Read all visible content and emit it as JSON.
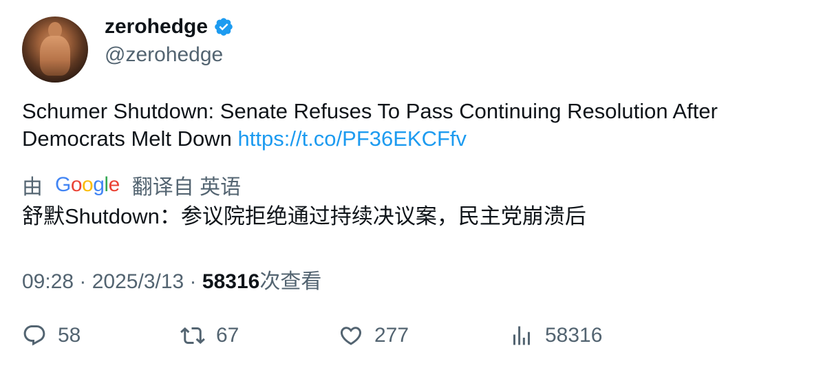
{
  "author": {
    "name": "zerohedge",
    "handle": "@zerohedge",
    "verified_icon": "verified-badge-icon",
    "avatar_icon": "avatar"
  },
  "tweet": {
    "text": "Schumer Shutdown: Senate Refuses To Pass Continuing Resolution After Democrats Melt Down ",
    "link": "https://t.co/PF36EKCFfv"
  },
  "translation": {
    "prefix": "由",
    "provider_logo_letters": [
      "G",
      "o",
      "o",
      "g",
      "l",
      "e"
    ],
    "suffix": "翻译自 英语",
    "text": "舒默Shutdown：参议院拒绝通过持续决议案，民主党崩溃后"
  },
  "meta": {
    "time": "09:28",
    "separator": " · ",
    "date": "2025/3/13",
    "views_count": "58316",
    "views_label": "次查看"
  },
  "actions": {
    "reply_count": "58",
    "retweet_count": "67",
    "like_count": "277",
    "views_count": "58316"
  },
  "colors": {
    "text": "#0f1419",
    "secondary": "#536471",
    "link": "#1d9bf0",
    "verified": "#1d9bf0"
  }
}
